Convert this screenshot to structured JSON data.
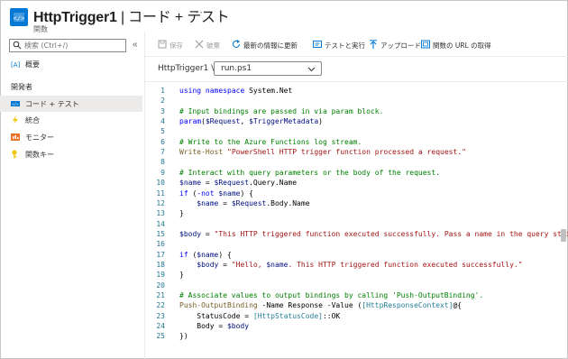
{
  "header": {
    "title_name": "HttpTrigger1",
    "title_sep": " | ",
    "title_page": "コード + テスト",
    "more": "···",
    "subtitle": "関数"
  },
  "sidebar": {
    "search_placeholder": "検索 (Ctrl+/)",
    "collapse": "«",
    "overview": "概要",
    "section": "開発者",
    "items": [
      {
        "label": "コード + テスト",
        "icon": "code-icon"
      },
      {
        "label": "統合",
        "icon": "lightning-icon"
      },
      {
        "label": "モニター",
        "icon": "monitor-icon"
      },
      {
        "label": "関数キー",
        "icon": "key-icon"
      }
    ]
  },
  "toolbar": {
    "save": "保存",
    "discard": "破棄",
    "refresh": "最新の情報に更新",
    "test": "テストと実行",
    "upload": "アップロード",
    "get_url": "関数の URL の取得"
  },
  "file": {
    "breadcrumb": "HttpTrigger1",
    "separator": "\\",
    "selected": "run.ps1"
  },
  "colors": {
    "accent": "#0078d4",
    "line_number": "#237893",
    "keyword": "#0000ff",
    "comment": "#008000",
    "string": "#a31515"
  },
  "code": [
    {
      "n": "1",
      "t": [
        [
          "kw",
          "using"
        ],
        [
          "op",
          " "
        ],
        [
          "kw",
          "namespace"
        ],
        [
          "op",
          " System.Net"
        ]
      ]
    },
    {
      "n": "2",
      "t": []
    },
    {
      "n": "3",
      "t": [
        [
          "cm",
          "# Input bindings are passed in via param block."
        ]
      ]
    },
    {
      "n": "4",
      "t": [
        [
          "kw",
          "param"
        ],
        [
          "op",
          "("
        ],
        [
          "var",
          "$Request"
        ],
        [
          "op",
          ", "
        ],
        [
          "var",
          "$TriggerMetadata"
        ],
        [
          "op",
          ")"
        ]
      ]
    },
    {
      "n": "5",
      "t": []
    },
    {
      "n": "6",
      "t": [
        [
          "cm",
          "# Write to the Azure Functions log stream."
        ]
      ]
    },
    {
      "n": "7",
      "t": [
        [
          "fn",
          "Write-Host"
        ],
        [
          "op",
          " "
        ],
        [
          "str",
          "\"PowerShell HTTP trigger function processed a request.\""
        ]
      ]
    },
    {
      "n": "8",
      "t": []
    },
    {
      "n": "9",
      "t": [
        [
          "cm",
          "# Interact with query parameters or the body of the request."
        ]
      ]
    },
    {
      "n": "10",
      "t": [
        [
          "var",
          "$name"
        ],
        [
          "op",
          " = "
        ],
        [
          "var",
          "$Request"
        ],
        [
          "op",
          ".Query.Name"
        ]
      ]
    },
    {
      "n": "11",
      "t": [
        [
          "kw",
          "if"
        ],
        [
          "op",
          " ("
        ],
        [
          "kw",
          "-not"
        ],
        [
          "op",
          " "
        ],
        [
          "var",
          "$name"
        ],
        [
          "op",
          ") {"
        ]
      ]
    },
    {
      "n": "12",
      "t": [
        [
          "op",
          "    "
        ],
        [
          "var",
          "$name"
        ],
        [
          "op",
          " = "
        ],
        [
          "var",
          "$Request"
        ],
        [
          "op",
          ".Body.Name"
        ]
      ]
    },
    {
      "n": "13",
      "t": [
        [
          "op",
          "}"
        ]
      ]
    },
    {
      "n": "14",
      "t": []
    },
    {
      "n": "15",
      "t": [
        [
          "var",
          "$body"
        ],
        [
          "op",
          " = "
        ],
        [
          "str",
          "\"This HTTP triggered function executed successfully. Pass a name in the query string"
        ]
      ]
    },
    {
      "n": "16",
      "t": []
    },
    {
      "n": "17",
      "t": [
        [
          "kw",
          "if"
        ],
        [
          "op",
          " ("
        ],
        [
          "var",
          "$name"
        ],
        [
          "op",
          ") {"
        ]
      ]
    },
    {
      "n": "18",
      "t": [
        [
          "op",
          "    "
        ],
        [
          "var",
          "$body"
        ],
        [
          "op",
          " = "
        ],
        [
          "str",
          "\"Hello, "
        ],
        [
          "var",
          "$name"
        ],
        [
          "str",
          ". This HTTP triggered function executed successfully.\""
        ]
      ]
    },
    {
      "n": "19",
      "t": [
        [
          "op",
          "}"
        ]
      ]
    },
    {
      "n": "20",
      "t": []
    },
    {
      "n": "21",
      "t": [
        [
          "cm",
          "# Associate values to output bindings by calling 'Push-OutputBinding'."
        ]
      ]
    },
    {
      "n": "22",
      "t": [
        [
          "fn",
          "Push-OutputBinding"
        ],
        [
          "op",
          " -Name Response -Value ("
        ],
        [
          "type",
          "[HttpResponseContext]"
        ],
        [
          "op",
          "@{"
        ]
      ]
    },
    {
      "n": "23",
      "t": [
        [
          "op",
          "    StatusCode = "
        ],
        [
          "type",
          "[HttpStatusCode]"
        ],
        [
          "op",
          "::OK"
        ]
      ]
    },
    {
      "n": "24",
      "t": [
        [
          "op",
          "    Body = "
        ],
        [
          "var",
          "$body"
        ]
      ]
    },
    {
      "n": "25",
      "t": [
        [
          "op",
          "})"
        ]
      ]
    }
  ]
}
